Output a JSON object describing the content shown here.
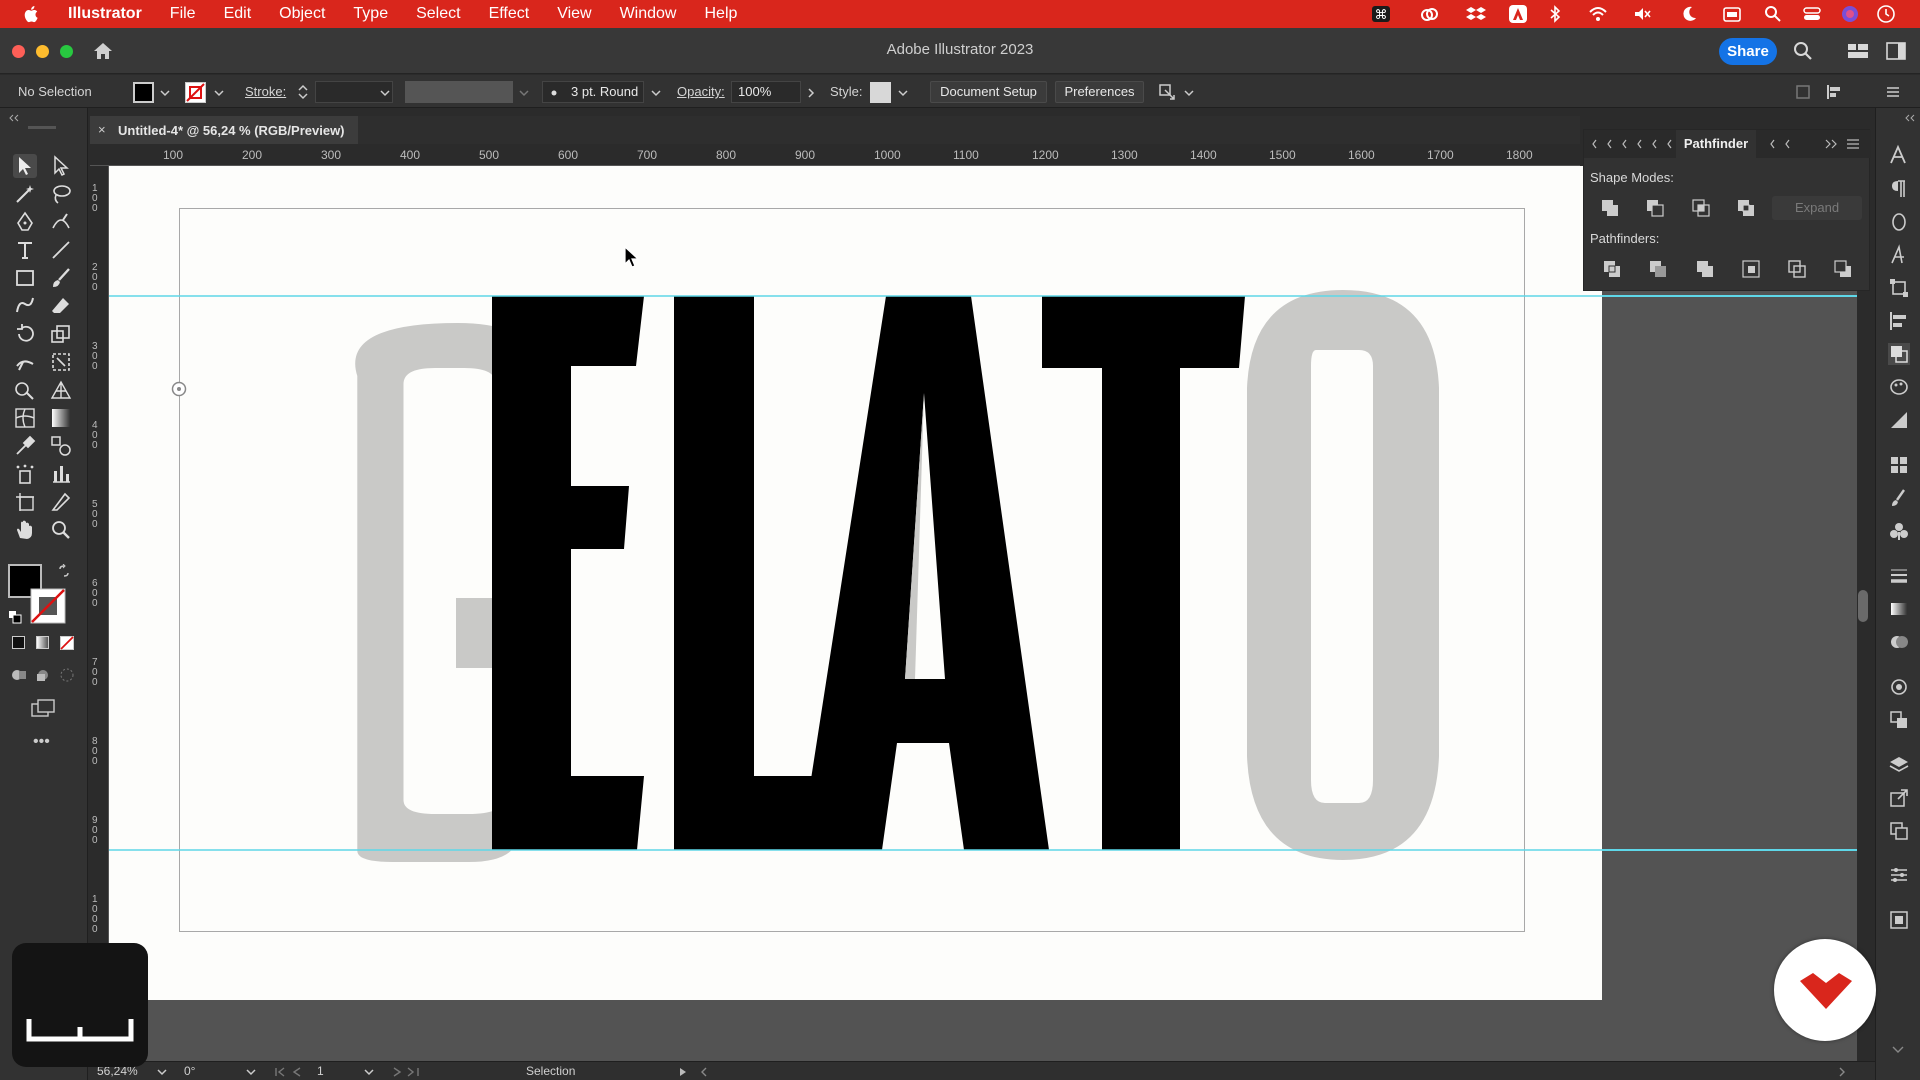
{
  "menubar": {
    "app_name": "Illustrator",
    "items": [
      "File",
      "Edit",
      "Object",
      "Type",
      "Select",
      "Effect",
      "View",
      "Window",
      "Help"
    ],
    "accent_color": "#d9261c"
  },
  "window": {
    "title": "Adobe Illustrator 2023",
    "share_label": "Share"
  },
  "controlbar": {
    "selection_status": "No Selection",
    "stroke_label": "Stroke:",
    "brush_label": "3 pt. Round",
    "opacity_label": "Opacity:",
    "opacity_value": "100%",
    "style_label": "Style:",
    "document_setup_label": "Document Setup",
    "preferences_label": "Preferences"
  },
  "document_tab": {
    "close_glyph": "×",
    "title": "Untitled-4* @ 56,24 % (RGB/Preview)"
  },
  "ruler": {
    "horizontal": [
      "100",
      "200",
      "300",
      "400",
      "500",
      "600",
      "700",
      "800",
      "900",
      "1000",
      "1100",
      "1200",
      "1300",
      "1400",
      "1500",
      "1600",
      "1700",
      "1800"
    ],
    "vertical": [
      "100",
      "200",
      "300",
      "400",
      "500",
      "600",
      "700",
      "800",
      "900",
      "1000"
    ]
  },
  "artboard": {
    "word_letters": [
      "G",
      "E",
      "L",
      "A",
      "T",
      "O"
    ],
    "solid_color": "#000000",
    "faded_color": "#c8c8c6",
    "guide_color": "#5ed7e8"
  },
  "pathfinder": {
    "tab_label": "Pathfinder",
    "shape_modes_label": "Shape Modes:",
    "pathfinders_label": "Pathfinders:",
    "expand_label": "Expand"
  },
  "statusbar": {
    "zoom": "56,24%",
    "rotation": "0°",
    "artboard_number": "1",
    "tool_name": "Selection"
  },
  "overlay": {
    "brand_color": "#d9261c"
  }
}
